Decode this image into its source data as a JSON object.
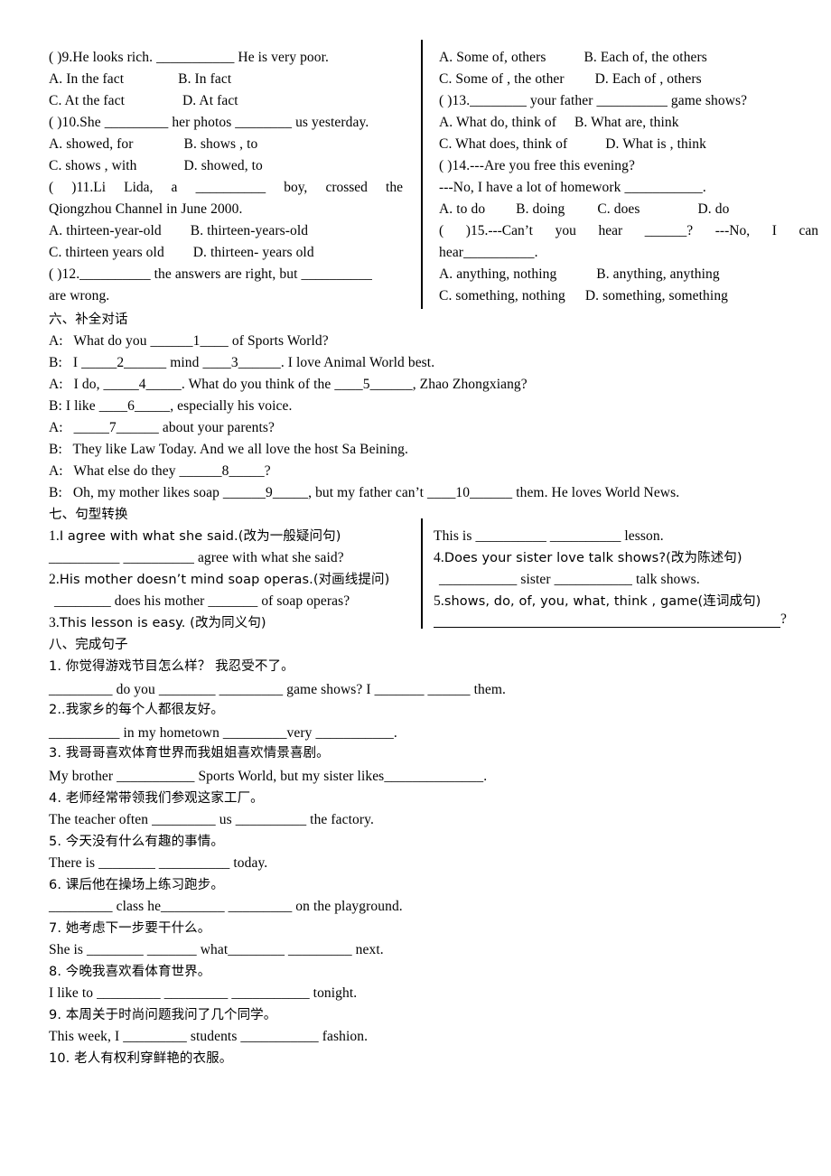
{
  "document": {
    "type": "english-exam-worksheet",
    "language": "en-zh"
  },
  "multiple_choice": {
    "left_column": [
      {
        "id": "q9",
        "stem": "(    )9.He looks rich. ___________ He is very poor."
      },
      {
        "id": "q9a",
        "optionA": "A. In the fact",
        "optionB": "B. In fact"
      },
      {
        "id": "q9c",
        "optionC": "C. At the fact",
        "optionD": "D. At fact"
      },
      {
        "id": "q10",
        "stem": "(    )10.She _________ her photos ________ us yesterday."
      },
      {
        "id": "q10a",
        "optionA": "A. showed, for",
        "optionB": "B. shows , to"
      },
      {
        "id": "q10c",
        "optionC": "C. shows , with",
        "optionD": "D. showed, to"
      },
      {
        "id": "q11",
        "stem_part1": "(      )11.Li  Lida,  a  __________  boy,  crossed  the",
        "stem_part2": "Qiongzhou Channel in June 2000."
      },
      {
        "id": "q11a",
        "optionA": "A. thirteen-year-old",
        "optionB": "B. thirteen-years-old"
      },
      {
        "id": "q11c",
        "optionC": "C. thirteen years old",
        "optionD": "D. thirteen- years old"
      },
      {
        "id": "q12",
        "stem_part1": "(    )12.__________ the answers are right, but __________",
        "stem_part2": "are wrong."
      }
    ],
    "right_column": [
      {
        "id": "q12a",
        "optionA": "A. Some of, others",
        "optionB": "B. Each of, the others"
      },
      {
        "id": "q12c",
        "optionC": "C. Some of , the other",
        "optionD": "D. Each of , others"
      },
      {
        "id": "q13",
        "stem": "(    )13.________ your father __________ game shows?"
      },
      {
        "id": "q13a",
        "optionA": "A. What do, think of",
        "optionB": "B. What are, think"
      },
      {
        "id": "q13c",
        "optionC": "C. What does, think of",
        "optionD": "D. What is , think"
      },
      {
        "id": "q14",
        "stem_part1": "(    )14.---Are you free this evening?",
        "stem_part2": "---No, I have a lot of homework ___________."
      },
      {
        "id": "q14a",
        "optionA": "A. to do",
        "optionB": "B. doing",
        "optionC": "C. does",
        "optionD": "D. do"
      },
      {
        "id": "q15",
        "stem_part1": "(     )15.---Can’t  you  hear  ______?     ---No,  I  can",
        "stem_part2": "hear__________."
      },
      {
        "id": "q15a",
        "optionA": "A. anything, nothing",
        "optionB": "B. anything, anything"
      },
      {
        "id": "q15c",
        "optionC": "C. something, nothing",
        "optionD": "D. something, something"
      }
    ]
  },
  "section_six": {
    "heading": "六、补全对话",
    "lines": [
      {
        "speaker": "A:",
        "text": "What do you ______1____ of Sports World?"
      },
      {
        "speaker": "B:",
        "text": "I _____2______ mind ____3______. I love Animal World best."
      },
      {
        "speaker": "A:",
        "text": "I do, _____4_____. What do you think of the ____5______, Zhao Zhongxiang?"
      },
      {
        "speaker": "B:",
        "text": "I like ____6_____, especially his voice."
      },
      {
        "speaker": "A:",
        "text": "_____7______ about your parents?"
      },
      {
        "speaker": "B:",
        "text": "They like Law Today. And we all love the host Sa Beining."
      },
      {
        "speaker": "A:",
        "text": "What else do they ______8_____?"
      },
      {
        "speaker": "B:",
        "text": "Oh, my mother likes soap ______9_____, but my father can’t ____10______ them. He loves World News."
      }
    ]
  },
  "section_seven": {
    "heading": "七、句型转换",
    "left_items": [
      {
        "num": "1.",
        "prompt": "I agree with what she said.(改为一般疑问句)",
        "answer_line": "__________   __________  agree with what she said?"
      },
      {
        "num": "2.",
        "prompt": "His mother doesn’t mind soap operas.(对画线提问)",
        "answer_line": "________  does his mother _______ of soap operas?"
      },
      {
        "num": "3.",
        "prompt": "This lesson is easy. (改为同义句)"
      }
    ],
    "right_items": [
      {
        "answer_line": "This is __________    __________   lesson."
      },
      {
        "num": "4.",
        "prompt": "Does your sister love talk shows?(改为陈述句)",
        "answer_line": "___________ sister ___________ talk shows."
      },
      {
        "num": "5.",
        "prompt": "shows, do, of, you, what, think , game(连词成句)",
        "answer_line": "?"
      }
    ]
  },
  "section_eight": {
    "heading": "八、完成句子",
    "items": [
      {
        "num": "1.",
        "zh": "你觉得游戏节目怎么样？  我忍受不了。",
        "en": "_________ do you ________   _________ game shows? I _______   ______  them."
      },
      {
        "num": "2..",
        "zh": "我家乡的每个人都很友好。",
        "en": "__________ in my hometown _________very ___________."
      },
      {
        "num": "3.",
        "zh": "我哥哥喜欢体育世界而我姐姐喜欢情景喜剧。",
        "en": "My brother ___________ Sports World, but my sister likes______________."
      },
      {
        "num": "4.",
        "zh": "老师经常带领我们参观这家工厂。",
        "en": "The teacher often _________ us __________  the factory."
      },
      {
        "num": "5.",
        "zh": "今天没有什么有趣的事情。",
        "en": "There is ________  __________  today."
      },
      {
        "num": "6.",
        "zh": "课后他在操场上练习跑步。",
        "en": "_________ class he_________  _________ on the playground."
      },
      {
        "num": "7.",
        "zh": "她考虑下一步要干什么。",
        "en": "She is ________  _______ what________  _________ next."
      },
      {
        "num": "8.",
        "zh": "今晚我喜欢看体育世界。",
        "en": "I like to _________  _________  ___________ tonight."
      },
      {
        "num": "9.",
        "zh": "本周关于时尚问题我问了几个同学。",
        "en": "This week, I _________  students ___________ fashion."
      },
      {
        "num": "10.",
        "zh": "老人有权利穿鲜艳的衣服。",
        "en": ""
      }
    ]
  }
}
